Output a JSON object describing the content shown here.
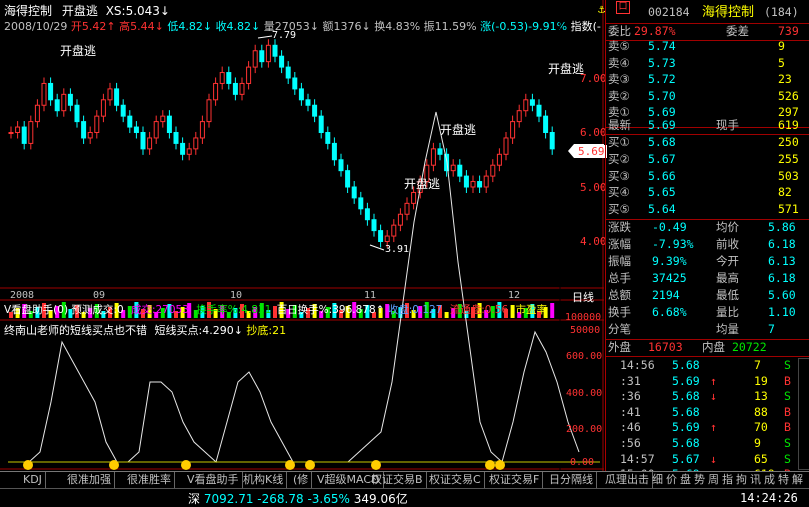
{
  "header": {
    "stock_name": "海得控制",
    "indicator_name": "开盘逃",
    "xs_label": "XS:5.043↓",
    "date": "2008/10/29",
    "open": "开5.42↑",
    "high": "高5.44↓",
    "low": "低4.82↓",
    "close": "收4.82↓",
    "volume": "量27053↓",
    "amount": "额1376↓",
    "turnover": "换4.83%",
    "amplitude": "振11.59%",
    "change": "涨(-0.53)-9.91%",
    "index_label": "指数(-"
  },
  "price_axis": [
    "7.00",
    "6.00",
    "5.00",
    "4.00"
  ],
  "current_price_tag": "5.69",
  "annotations": {
    "high_mark": "7.79",
    "low_mark": "3.91",
    "signals": [
      "开盘逃",
      "开盘逃",
      "开盘逃",
      "开盘逃"
    ]
  },
  "date_axis": [
    "2008",
    "09",
    "10",
    "11",
    "12"
  ],
  "period_label": "日线",
  "volume_panel": {
    "title": "V看盘助手(0)",
    "forecast": "预测成交:0",
    "volume_label": "成交:27053",
    "turnover_label": "换手率%:4.831",
    "hundred_day": "百日换手%:396.878↑",
    "shou_pan": "收盘:0.127",
    "circulation": "流通盘:0.56",
    "pe": "市盈率",
    "axis": [
      "100000",
      "50000"
    ]
  },
  "indicator_panel": {
    "title": "终南山老师的短线买点也不错",
    "buy_point": "短线买点:4.290↓",
    "bottom": "抄底:21",
    "axis": [
      "600.00",
      "400.00",
      "200.00",
      "0.00"
    ]
  },
  "right_panel": {
    "code": "002184",
    "name": "海得控制",
    "count": "(184)",
    "weibi_label": "委比",
    "weibi_value": "29.87%",
    "weicha_label": "委差",
    "weicha_value": "739",
    "asks": [
      {
        "label": "卖⑤",
        "price": "5.74",
        "vol": "9"
      },
      {
        "label": "卖④",
        "price": "5.73",
        "vol": "5"
      },
      {
        "label": "卖③",
        "price": "5.72",
        "vol": "23"
      },
      {
        "label": "卖②",
        "price": "5.70",
        "vol": "526"
      },
      {
        "label": "卖①",
        "price": "5.69",
        "vol": "297"
      }
    ],
    "latest_label": "最新",
    "latest_price": "5.69",
    "xianshou_label": "现手",
    "xianshou_value": "619",
    "bids": [
      {
        "label": "买①",
        "price": "5.68",
        "vol": "250"
      },
      {
        "label": "买②",
        "price": "5.67",
        "vol": "255"
      },
      {
        "label": "买③",
        "price": "5.66",
        "vol": "503"
      },
      {
        "label": "买④",
        "price": "5.65",
        "vol": "82"
      },
      {
        "label": "买⑤",
        "price": "5.64",
        "vol": "571"
      }
    ],
    "stats": [
      {
        "l1": "涨跌",
        "v1": "-0.49",
        "l2": "均价",
        "v2": "5.86"
      },
      {
        "l1": "涨幅",
        "v1": "-7.93%",
        "l2": "前收",
        "v2": "6.18"
      },
      {
        "l1": "振幅",
        "v1": "9.39%",
        "l2": "今开",
        "v2": "6.13"
      },
      {
        "l1": "总手",
        "v1": "37425",
        "l2": "最高",
        "v2": "6.18"
      },
      {
        "l1": "总额",
        "v1": "2194",
        "l2": "最低",
        "v2": "5.60"
      },
      {
        "l1": "换手",
        "v1": "6.68%",
        "l2": "量比",
        "v2": "1.10"
      },
      {
        "l1": "分笔",
        "v1": "",
        "l2": "均量",
        "v2": "7"
      }
    ],
    "waipan_label": "外盘",
    "waipan_value": "16703",
    "neipan_label": "内盘",
    "neipan_value": "20722",
    "ticks": [
      {
        "time": "14:56",
        "price": "5.68",
        "arrow": "",
        "vol": "7",
        "side": "S"
      },
      {
        "time": ":31",
        "price": "5.69",
        "arrow": "↑",
        "vol": "19",
        "side": "B"
      },
      {
        "time": ":36",
        "price": "5.68",
        "arrow": "↓",
        "vol": "13",
        "side": "S"
      },
      {
        "time": ":41",
        "price": "5.68",
        "arrow": "",
        "vol": "88",
        "side": "B"
      },
      {
        "time": ":46",
        "price": "5.69",
        "arrow": "↑",
        "vol": "70",
        "side": "B"
      },
      {
        "time": ":56",
        "price": "5.68",
        "arrow": "",
        "vol": "9",
        "side": "S"
      },
      {
        "time": "14:57",
        "price": "5.67",
        "arrow": "↓",
        "vol": "65",
        "side": "S"
      },
      {
        "time": "15:00",
        "price": "5.69",
        "arrow": "↑",
        "vol": "619",
        "side": "B"
      }
    ]
  },
  "bottom_tabs": [
    "KDJ",
    "很准加强",
    "很准胜率",
    "V看盘助手",
    "机构K线",
    "(修",
    "V超级MACD",
    "权证交易B",
    "权证交易C",
    "权证交易F",
    "日分隔线",
    "瓜理出击"
  ],
  "right_tabs": [
    "细",
    "价",
    "盘",
    "势",
    "周",
    "指",
    "拘",
    "讯",
    "成",
    "特",
    "解"
  ],
  "statusbar": {
    "market": "深",
    "index": "7092.71",
    "change": "-268.78",
    "pct": "-3.65%",
    "amount": "349.06亿",
    "time": "14:24:26"
  }
}
